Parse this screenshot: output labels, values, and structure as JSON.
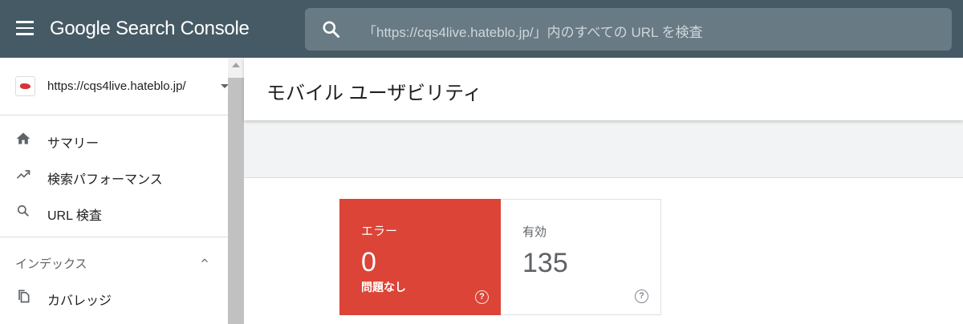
{
  "app": {
    "title": "Google Search Console"
  },
  "search": {
    "placeholder": "「https://cqs4live.hateblo.jp/」内のすべての URL を検査"
  },
  "property": {
    "url": "https://cqs4live.hateblo.jp/"
  },
  "sidebar": {
    "items": [
      {
        "label": "サマリー",
        "icon": "home-icon"
      },
      {
        "label": "検索パフォーマンス",
        "icon": "trending-up-icon"
      },
      {
        "label": "URL 検査",
        "icon": "search-icon"
      }
    ],
    "section": {
      "label": "インデックス",
      "icon": "chevron-up-icon"
    },
    "section_items": [
      {
        "label": "カバレッジ",
        "icon": "copy-icon"
      }
    ]
  },
  "page": {
    "title": "モバイル ユーザビリティ"
  },
  "cards": {
    "error": {
      "label": "エラー",
      "count": "0",
      "sublabel": "問題なし",
      "color": "#db4437"
    },
    "valid": {
      "label": "有効",
      "count": "135"
    },
    "help_glyph": "?"
  },
  "colors": {
    "topbar": "#455a64",
    "search_bg": "#687a84",
    "error": "#db4437"
  }
}
